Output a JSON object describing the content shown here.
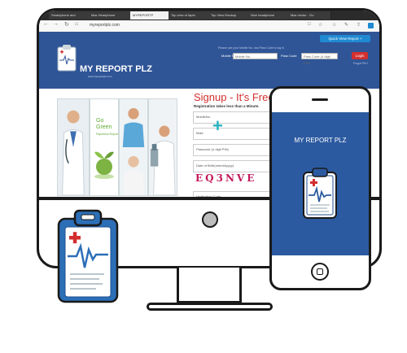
{
  "browser": {
    "tabs": [
      {
        "label": "Smartphone and"
      },
      {
        "label": "Max Headphone"
      },
      {
        "label": "MYREPORTP"
      },
      {
        "label": "Top view of lapto"
      },
      {
        "label": "Top View Mockup"
      },
      {
        "label": "Nice headphone"
      },
      {
        "label": "Mac vector · Go"
      }
    ],
    "active_tab_index": 2,
    "url": "myreportplz.com",
    "nav": {
      "back": "←",
      "forward": "→",
      "reload": "↻",
      "home": "⌂"
    },
    "toolbar": {
      "reader": "□",
      "favorite": "☆",
      "hub": "☆",
      "notes": "✎",
      "share": "⇧"
    }
  },
  "site": {
    "quick_view_label": "Quick View Report +",
    "logo_text": "MY REPORT PLZ",
    "logo_sub": "www.myreportplz.com",
    "login_hint": "Please use your Mobile No. and Pass Code to log in",
    "mobile_label": "Mobile No",
    "mobile_placeholder": "Mobile No.",
    "pass_label": "Pass Code",
    "pass_placeholder": "Pass Code (4 digit PIN)",
    "login_label": "Login",
    "forgot_label": "Forgot Pin?"
  },
  "promo": {
    "go_green_title": "Go Green",
    "go_green_sub": "Paperless Report"
  },
  "signup": {
    "title": "Signup - It's Free",
    "subtitle": "Registration takes less than a Minute.",
    "fields": {
      "mobile": "MobileNo.",
      "male": "Male",
      "passcode": "Passcode (4 digit PIN)",
      "dob": "Date of Birth(mm/dd/yyyy)",
      "verification": "Verification Code"
    },
    "captcha": "EQ3NVE"
  },
  "phone": {
    "app_title": "MY REPORT PLZ"
  },
  "colors": {
    "brand_blue": "#2f5597",
    "phone_blue": "#2c5aa0",
    "accent_red": "#d32f2f",
    "accent_cyan": "#28b3c0",
    "go_green": "#5fa834",
    "captcha_magenta": "#c2185b"
  },
  "icons": [
    "clipboard-heartbeat-icon",
    "plus-icon",
    "power-button-icon",
    "home-button-icon"
  ]
}
